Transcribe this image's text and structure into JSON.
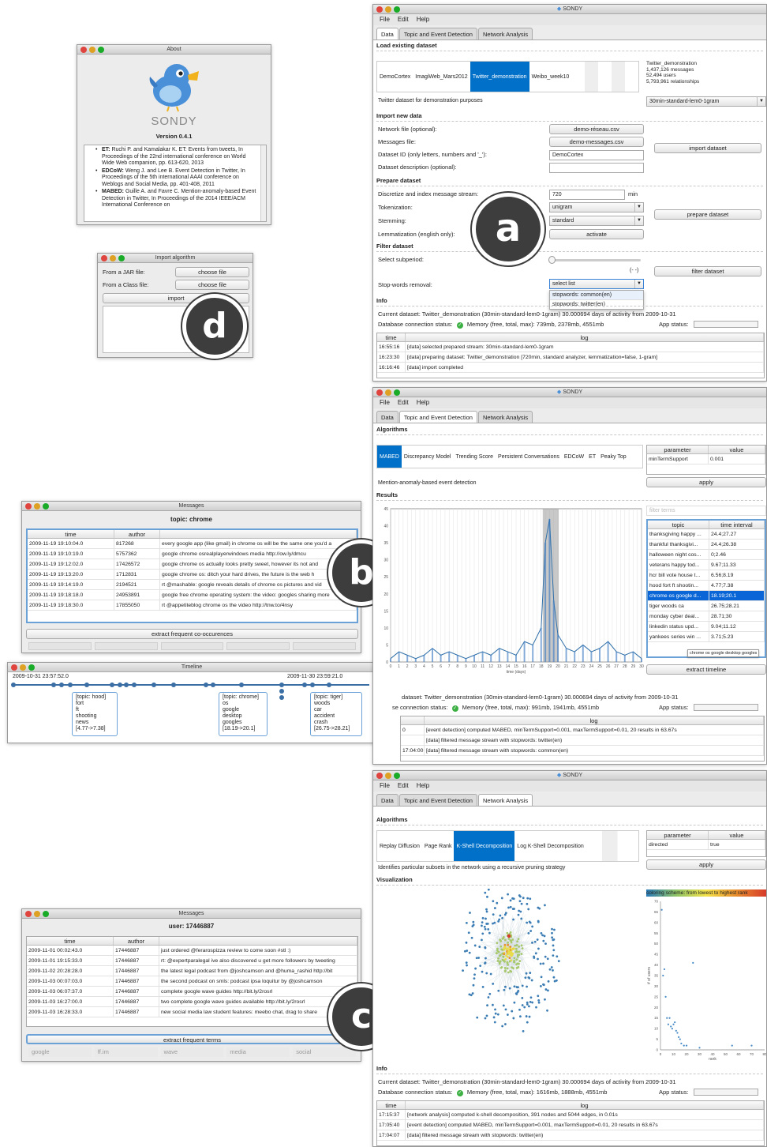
{
  "app": {
    "name": "SONDY",
    "menu": [
      "File",
      "Edit",
      "Help"
    ],
    "tabs": [
      "Data",
      "Topic and Event Detection",
      "Network Analysis"
    ]
  },
  "about": {
    "title": "About",
    "logo": "SONDY",
    "version": "Version 0.4.1",
    "refs": [
      {
        "key": "ET:",
        "text": "Ruchi P. and Kamalakar K. ET: Events from tweets, In Proceedings of the 22nd international conference on World Wide Web companion, pp. 613-620, 2013"
      },
      {
        "key": "EDCoW:",
        "text": "Weng J. and Lee B. Event Detection in Twitter, In Proceedings of the 5th international AAAI conference on Weblogs and Social Media, pp. 401-408, 2011"
      },
      {
        "key": "MABED:",
        "text": "Guille A. and Favre C. Mention-anomaly-based Event Detection in Twitter, In Proceedings of the 2014 IEEE/ACM International Conference on"
      }
    ]
  },
  "import_alg": {
    "title": "Import algorithm",
    "jar_label": "From a JAR file:",
    "class_label": "From a Class file:",
    "choose": "choose file",
    "import": "import"
  },
  "markers": {
    "a": "a",
    "b": "b",
    "c": "c",
    "d": "d"
  },
  "data_win": {
    "load_title": "Load existing dataset",
    "datasets": [
      "DemoCortex",
      "ImagiWeb_Mars2012",
      "Twitter_demonstration",
      "Weibo_week10"
    ],
    "info": [
      "Twitter_demonstration",
      "1,437,126 messages",
      "52,494 users",
      "5,793,961 relationships"
    ],
    "desc": "Twitter dataset for demonstration purposes",
    "stream": "30min-standard-lem0-1gram",
    "import_title": "Import new data",
    "net_label": "Network file (optional):",
    "net_btn": "demo-réseau.csv",
    "msg_label": "Messages file:",
    "msg_btn": "demo-messages.csv",
    "id_label": "Dataset ID (only letters, numbers and '_'):",
    "id_val": "DemoCortex",
    "desc_label": "Dataset description (optional):",
    "import_btn": "import dataset",
    "prep_title": "Prepare dataset",
    "disc_label": "Discretize and index message stream:",
    "disc_val": "720",
    "min": "min",
    "tok_label": "Tokenization:",
    "tok_val": "unigram",
    "stem_label": "Stemming:",
    "stem_val": "standard",
    "lem_label": "Lemmatization (english only):",
    "lem_btn": "activate",
    "prep_btn": "prepare dataset",
    "filter_title": "Filter dataset",
    "sub_label": "Select subperiod:",
    "range": "(- -)",
    "filter_btn": "filter dataset",
    "stop_label": "Stop-words removal:",
    "stop_sel": "select list",
    "stop_opts": [
      "stopwords: common(en)",
      "stopwords: twitter(en)"
    ],
    "info_title": "Info",
    "current": "Current dataset:  Twitter_demonstration  (30min-standard-lem0-1gram) 30.000694 days of activity from 2009-10-31",
    "db": "Database connection status:",
    "mem": "Memory (free, total, max):  739mb, 2378mb, 4551mb",
    "app_status": "App status:",
    "log_cols": [
      "time",
      "log"
    ],
    "log": [
      [
        "16:55:16",
        "[data] selected prepared stream: 30min-standard-lem0-1gram"
      ],
      [
        "16:23:30",
        "[data] preparing dataset: Twitter_demonstration [720min, standard analyzer, lemmatization=false, 1-gram]"
      ],
      [
        "16:16:46",
        "[data] import completed"
      ]
    ]
  },
  "topic_win": {
    "alg_title": "Algorithms",
    "algs": [
      "MABED",
      "Discrepancy Model",
      "Trending Score",
      "Persistent Conversations",
      "EDCoW",
      "ET",
      "Peaky Top"
    ],
    "param_cols": [
      "parameter",
      "value"
    ],
    "param": [
      "minTermSupport",
      "0.001"
    ],
    "apply": "apply",
    "alg_desc": "Mention-anomaly-based event detection",
    "results_title": "Results",
    "filter_ph": "filter terms",
    "topic_cols": [
      "topic",
      "time interval"
    ],
    "topics": [
      [
        "thanksgiving happy ...",
        "24.4;27.27"
      ],
      [
        "thankful thanksgivi...",
        "24.4;26.38"
      ],
      [
        "halloween night cos...",
        "0;2.46"
      ],
      [
        "veterans happy tod...",
        "9.67;11.33"
      ],
      [
        "hcr bill vote house t...",
        "6.56;8.19"
      ],
      [
        "hood fort ft shootin...",
        "4.77;7.38"
      ],
      [
        "chrome os google d...",
        "18.19;20.1"
      ],
      [
        "tiger woods ca",
        "26.75;28.21"
      ],
      [
        "monday cyber deal...",
        "28.71;30"
      ],
      [
        "linkedin status upd...",
        "9.04;11.12"
      ],
      [
        "yankees series win ...",
        "3.71;5.23"
      ]
    ],
    "tooltip": "chrome os google desktop googles",
    "extract": "extract timeline",
    "xlabel": "time (days)",
    "current": "dataset:  Twitter_demonstration  (30min-standard-lem0-1gram) 30.000694 days of activity from 2009-10-31",
    "db": "se connection status:",
    "mem": "Memory (free, total, max):  991mb, 1941mb, 4551mb",
    "app_status": "App status:",
    "log_col": "log",
    "log": [
      [
        "0",
        "[event detection] computed MABED, minTermSupport=0.001, maxTermSupport=0.01, 20 results in 63.67s"
      ],
      [
        "",
        "[data] filtered message stream with stopwords: twitter(en)"
      ],
      [
        "17:04:00",
        "[data] filtered message stream with stopwords: common(en)"
      ]
    ]
  },
  "net_win": {
    "alg_title": "Algorithms",
    "algs": [
      "Replay Diffusion",
      "Page Rank",
      "K-Shell Decomposition",
      "Log K-Shell Decomposition"
    ],
    "param_cols": [
      "parameter",
      "value"
    ],
    "param": [
      "directed",
      "true"
    ],
    "apply": "apply",
    "alg_desc": "Identifies particular subsets in the network using a recursive pruning strategy",
    "vis_title": "Visualization",
    "coloring": "coloring scheme: from lowest to highest rank",
    "ylabel": "# of users",
    "xlabel": "rank",
    "info_title": "Info",
    "current": "Current dataset:  Twitter_demonstration  (30min-standard-lem0-1gram) 30.000694 days of activity from 2009-10-31",
    "db": "Database connection status:",
    "mem": "Memory (free, total, max):  1616mb, 1888mb, 4551mb",
    "app_status": "App status:",
    "log_cols": [
      "time",
      "log"
    ],
    "log": [
      [
        "17:15:37",
        "[network analysis] computed k-shell decomposition, 391 nodes and 5044 edges, in 0.01s"
      ],
      [
        "17:05:40",
        "[event detection] computed MABED, minTermSupport=0.001, maxTermSupport=0.01, 20 results in 63.67s"
      ],
      [
        "17:04:07",
        "[data] filtered message stream with stopwords: twitter(en)"
      ]
    ]
  },
  "messages1": {
    "title": "Messages",
    "heading": "topic: chrome",
    "cols": [
      "time",
      "author",
      ""
    ],
    "rows": [
      [
        "2009-11-19 19:10:04.0",
        "817268",
        "every google app (like gmail) in chrome os will be the same one you'd a"
      ],
      [
        "2009-11-19 19:10:19.0",
        "5757362",
        "google chrome osrealplayerwindows media http://ow.ly/dmcu"
      ],
      [
        "2009-11-19 19:12:02.0",
        "17426572",
        "google chrome os actually looks pretty sweet, however its not and"
      ],
      [
        "2009-11-19 19:13:20.0",
        "1712831",
        "google chrome os: ditch your hard drives, the future is the web h"
      ],
      [
        "2009-11-19 19:14:19.0",
        "2194521",
        "rt @mashable: google reveals details of chrome os pictures and vid"
      ],
      [
        "2009-11-19 19:18:18.0",
        "24953891",
        "google free chrome operating system: the video: googles sharing more"
      ],
      [
        "2009-11-19 19:18:30.0",
        "17855050",
        "rt @appetiteblog chrome os  the video http://tnw.to/4nsy"
      ]
    ],
    "extract": "extract frequent co-occurences"
  },
  "timeline": {
    "title": "Timeline",
    "start": "2009-10-31 23:57:52.0",
    "end": "2009-11-30 23:59:21.0",
    "boxes": [
      [
        "[topic: hood]",
        "fort",
        "ft",
        "shooting",
        "news",
        "[4.77->7.38]"
      ],
      [
        "[topic: chrome]",
        "os",
        "google",
        "desktop",
        "googles",
        "[18.19->20.1]"
      ],
      [
        "[topic: tiger]",
        "woods",
        "car",
        "accident",
        "crash",
        "[26.75->28.21]"
      ]
    ]
  },
  "messages2": {
    "title": "Messages",
    "heading": "user: 17446887",
    "cols": [
      "time",
      "author",
      ""
    ],
    "rows": [
      [
        "2009-11-01 00:02:43.0",
        "17446887",
        "just ordered @ferarospizza review to come soon #stl :)"
      ],
      [
        "2009-11-01 19:15:33.0",
        "17446887",
        "rt: @expertparalegal ive also discovered u get more followers by tweeting"
      ],
      [
        "2009-11-02 20:28:28.0",
        "17446887",
        "the latest legal podcast from @joshcamson and @huma_rashid  http://bit"
      ],
      [
        "2009-11-03 00:07:03.0",
        "17446887",
        "the second podcast on smls: podcast ipsa loquitur by @joshcamson"
      ],
      [
        "2009-11-03 06:07:37.0",
        "17446887",
        "complete google wave guides  http://bit.ly/2rosrl"
      ],
      [
        "2009-11-03 16:27:00.0",
        "17446887",
        "two complete google wave guides available  http://bit.ly/2rosrl"
      ],
      [
        "2009-11-03 16:28:33.0",
        "17446887",
        "new social media law student features: meebo chat, drag to share"
      ]
    ],
    "extract": "extract frequent terms",
    "terms": [
      "google",
      "ff.im",
      "wave",
      "media",
      "social"
    ]
  },
  "chart_data": [
    {
      "type": "line",
      "xlabel": "time (days)",
      "ylabel": "",
      "xlim": [
        0,
        30
      ],
      "ylim": [
        0,
        45
      ],
      "yticks": [
        0,
        5,
        10,
        15,
        20,
        25,
        30,
        35,
        40,
        45
      ],
      "xticks": [
        0,
        1,
        2,
        3,
        4,
        5,
        6,
        7,
        8,
        9,
        10,
        11,
        12,
        13,
        14,
        15,
        16,
        17,
        18,
        19,
        20,
        21,
        22,
        23,
        24,
        25,
        26,
        27,
        28,
        29,
        30
      ],
      "highlight": [
        18.19,
        20.1
      ],
      "series": [
        {
          "values_x": [
            0,
            1,
            2,
            3,
            4,
            5,
            6,
            7,
            8,
            9,
            10,
            11,
            12,
            13,
            14,
            15,
            16,
            17,
            18,
            18.5,
            19,
            19.5,
            20,
            21,
            22,
            23,
            24,
            25,
            26,
            27,
            28,
            29,
            30
          ],
          "values_y": [
            1,
            3,
            2,
            1,
            2,
            4,
            2,
            3,
            2,
            1,
            2,
            3,
            2,
            4,
            3,
            2,
            6,
            5,
            10,
            35,
            42,
            18,
            8,
            4,
            3,
            5,
            3,
            4,
            6,
            3,
            2,
            3,
            1
          ]
        }
      ]
    },
    {
      "type": "scatter",
      "xlabel": "rank",
      "ylabel": "# of users",
      "xlim": [
        0,
        80
      ],
      "ylim": [
        0,
        70
      ],
      "yticks": [
        0,
        5,
        10,
        15,
        20,
        25,
        30,
        35,
        40,
        45,
        50,
        55,
        60,
        65,
        70
      ],
      "xticks": [
        0,
        10,
        20,
        30,
        40,
        50,
        60,
        70,
        80
      ],
      "series": [
        {
          "values_x": [
            1,
            2,
            3,
            4,
            5,
            6,
            7,
            8,
            9,
            10,
            11,
            12,
            13,
            14,
            15,
            16,
            18,
            20,
            25,
            30,
            55,
            70
          ],
          "values_y": [
            66,
            35,
            38,
            25,
            15,
            12,
            15,
            11,
            10,
            12,
            13,
            9,
            8,
            6,
            5,
            3,
            2,
            2,
            41,
            1,
            2,
            2
          ]
        }
      ]
    }
  ]
}
